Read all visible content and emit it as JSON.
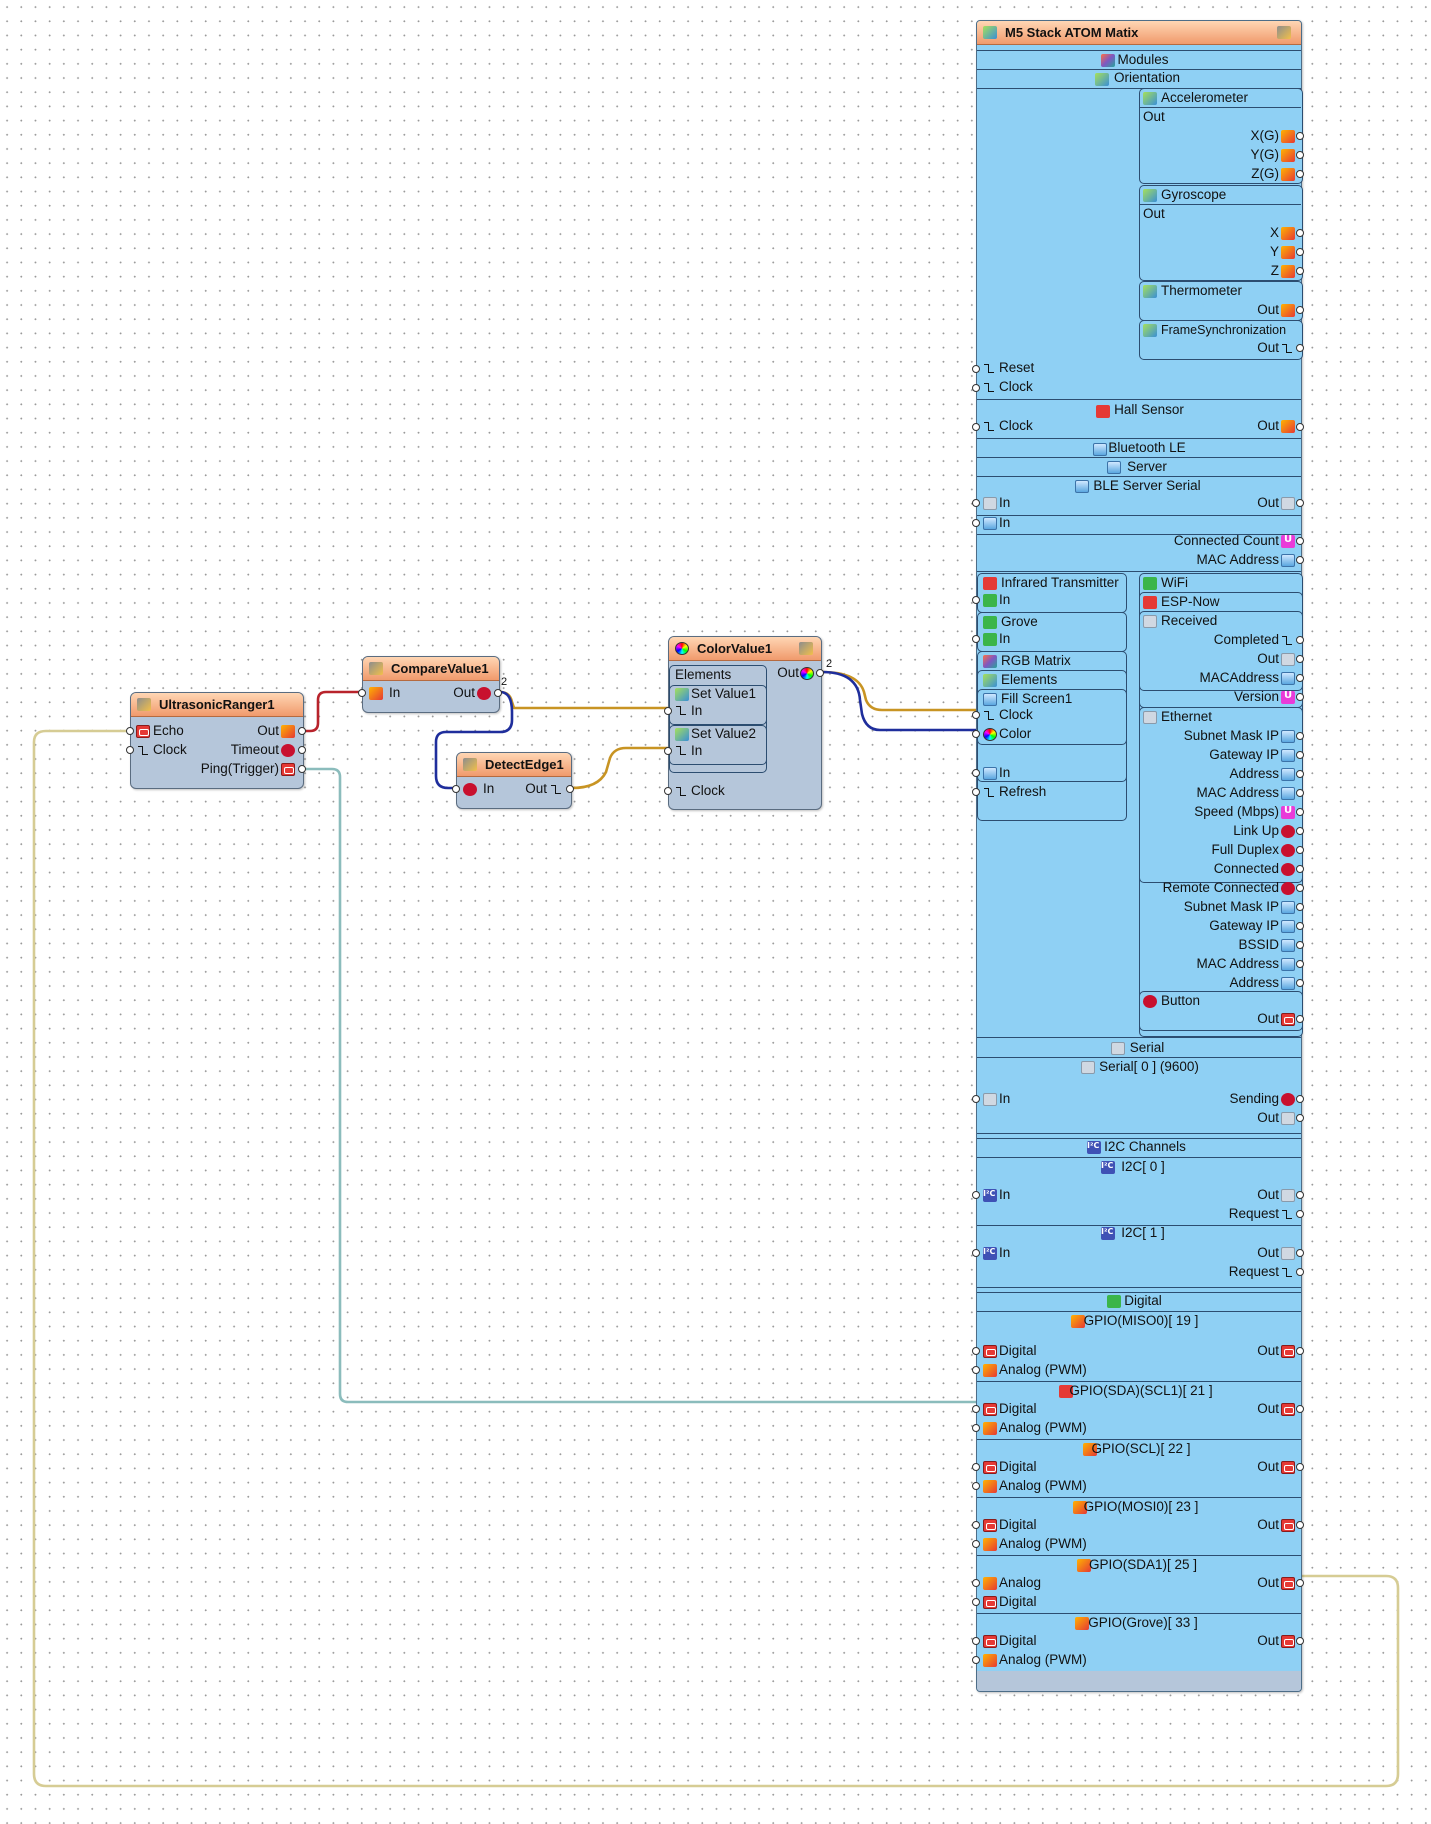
{
  "colors": {
    "wire_red": "#b8232b",
    "wire_gold": "#c89423",
    "wire_navy": "#1f2e9c",
    "wire_teal": "#8bbcbc",
    "wire_tan": "#d6cc94",
    "title_bar": "#f3a679",
    "panel": "#8fd0f4",
    "component_body": "#b5c6da"
  },
  "ultrasonic": {
    "title": "UltrasonicRanger1",
    "in1": "Echo",
    "in2": "Clock",
    "out1": "Out",
    "out2": "Timeout",
    "out3": "Ping(Trigger)"
  },
  "compare": {
    "title": "CompareValue1",
    "in": "In",
    "out": "Out",
    "out_count": "2"
  },
  "detect": {
    "title": "DetectEdge1",
    "in": "In",
    "out": "Out"
  },
  "color": {
    "title": "ColorValue1",
    "elements": "Elements",
    "set1": "Set Value1",
    "in1": "In",
    "set2": "Set Value2",
    "in2": "In",
    "clock": "Clock",
    "out": "Out",
    "out_count": "2"
  },
  "m5": {
    "title": "M5 Stack ATOM Matix",
    "modules": "Modules",
    "orientation": "Orientation",
    "accel": {
      "title": "Accelerometer",
      "out": "Out",
      "x": "X(G)",
      "y": "Y(G)",
      "z": "Z(G)"
    },
    "gyro": {
      "title": "Gyroscope",
      "out": "Out",
      "x": "X",
      "y": "Y",
      "z": "Z"
    },
    "thermo": {
      "title": "Thermometer",
      "out": "Out"
    },
    "frame": {
      "title": "FrameSynchronization",
      "out": "Out"
    },
    "reset": "Reset",
    "clock": "Clock",
    "hall": {
      "title": "Hall Sensor",
      "clock": "Clock",
      "out": "Out"
    },
    "ble": {
      "title": "Bluetooth LE",
      "server": "Server",
      "serial": "BLE Server Serial",
      "in1": "In",
      "out1": "Out",
      "in2": "In",
      "connected_count": "Connected Count",
      "mac": "MAC Address"
    },
    "ir": {
      "title": "Infrared Transmitter",
      "in": "In"
    },
    "grove": {
      "title": "Grove",
      "in": "In"
    },
    "rgb": {
      "title": "RGB Matrix",
      "elements": "Elements",
      "fill": "Fill Screen1",
      "clock": "Clock",
      "color": "Color",
      "in": "In",
      "refresh": "Refresh"
    },
    "wifi": {
      "title": "WiFi",
      "espnow": "ESP-Now",
      "received": "Received",
      "completed": "Completed",
      "out": "Out",
      "macaddress": "MACAddress",
      "version": "Version"
    },
    "eth": {
      "title": "Ethernet",
      "subnet": "Subnet Mask IP",
      "gateway": "Gateway IP",
      "address": "Address",
      "mac": "MAC Address",
      "speed": "Speed (Mbps)",
      "linkup": "Link Up",
      "duplex": "Full Duplex",
      "connected": "Connected"
    },
    "remote": {
      "connected": "Remote Connected",
      "subnet": "Subnet Mask IP",
      "gateway": "Gateway IP",
      "bssid": "BSSID",
      "mac": "MAC Address",
      "address": "Address"
    },
    "button": {
      "title": "Button",
      "out": "Out"
    },
    "serial": {
      "title": "Serial",
      "port": "Serial[ 0 ] (9600)",
      "in": "In",
      "sending": "Sending",
      "out": "Out"
    },
    "i2c": {
      "title": "I2C Channels",
      "ch0": "I2C[ 0 ]",
      "ch1": "I2C[ 1 ]",
      "in": "In",
      "out": "Out",
      "request": "Request"
    },
    "digital": {
      "title": "Digital",
      "gpio19": "GPIO(MISO0)[ 19 ]",
      "gpio21": "GPIO(SDA)(SCL1)[ 21 ]",
      "gpio22": "GPIO(SCL)[ 22 ]",
      "gpio23": "GPIO(MOSI0)[ 23 ]",
      "gpio25": "GPIO(SDA1)[ 25 ]",
      "gpio33": "GPIO(Grove)[ 33 ]",
      "digital": "Digital",
      "analog_pwm": "Analog (PWM)",
      "analog": "Analog",
      "out": "Out"
    }
  }
}
